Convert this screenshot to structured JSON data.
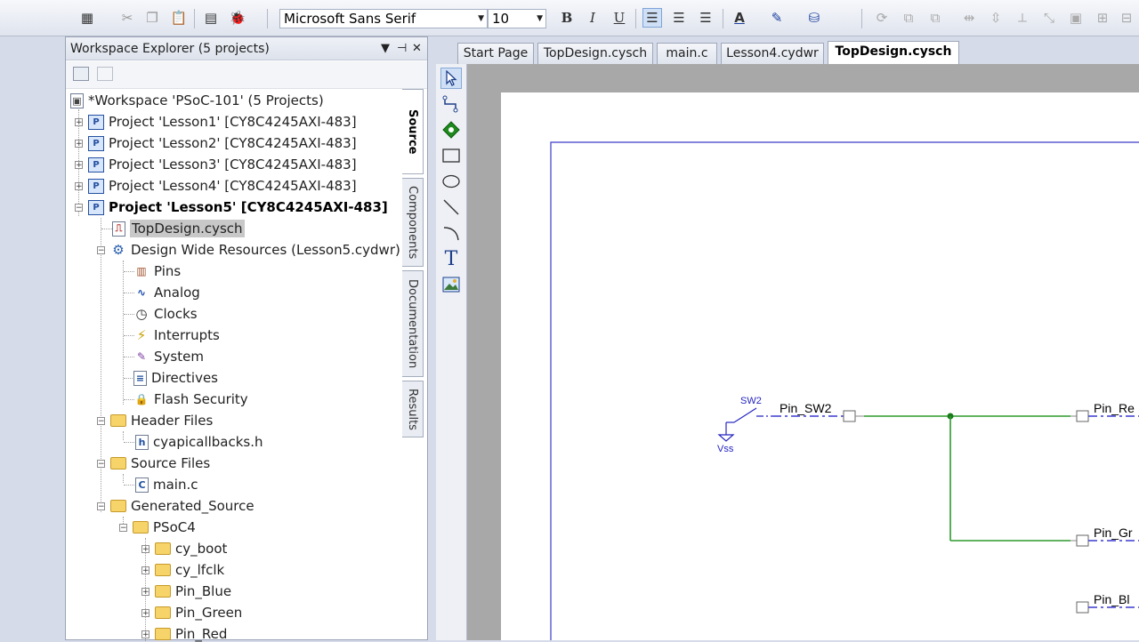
{
  "toolbar": {
    "font_name": "Microsoft Sans Serif",
    "font_size": "10",
    "bold_label": "B",
    "italic_label": "I",
    "underline_label": "U",
    "font_color_label": "A"
  },
  "explorer": {
    "title": "Workspace Explorer (5 projects)",
    "pin_icon": "pin-icon",
    "close_icon": "close-icon",
    "tree": {
      "workspace": "*Workspace 'PSoC-101' (5 Projects)",
      "projects": [
        "Project  'Lesson1' [CY8C4245AXI-483]",
        "Project  'Lesson2' [CY8C4245AXI-483]",
        "Project  'Lesson3' [CY8C4245AXI-483]",
        "Project  'Lesson4' [CY8C4245AXI-483]",
        "Project  'Lesson5' [CY8C4245AXI-483]"
      ],
      "topdesign": "TopDesign.cysch",
      "dwr": "Design Wide Resources (Lesson5.cydwr)",
      "dwr_items": [
        "Pins",
        "Analog",
        "Clocks",
        "Interrupts",
        "System",
        "Directives",
        "Flash Security"
      ],
      "header_files": "Header Files",
      "header_file_items": [
        "cyapicallbacks.h"
      ],
      "source_files": "Source Files",
      "source_file_items": [
        "main.c"
      ],
      "generated_source": "Generated_Source",
      "psoc4": "PSoC4",
      "psoc4_items": [
        "cy_boot",
        "cy_lfclk",
        "Pin_Blue",
        "Pin_Green",
        "Pin_Red"
      ]
    },
    "side_tabs": [
      "Source",
      "Components",
      "Documentation",
      "Results"
    ]
  },
  "doc_tabs": [
    "Start Page",
    "TopDesign.cysch",
    "main.c",
    "Lesson4.cydwr",
    "TopDesign.cysch"
  ],
  "palette_tools": [
    "select-icon",
    "wire-icon",
    "component-icon",
    "rectangle-icon",
    "ellipse-icon",
    "line-icon",
    "arc-icon",
    "text-icon",
    "image-icon"
  ],
  "schematic": {
    "switch_label": "SW2",
    "vss_label": "Vss",
    "pin_sw2": "Pin_SW2",
    "pin_red": "Pin_Re",
    "pin_green": "Pin_Gr",
    "pin_blue": "Pin_Bl",
    "wire_color": "#2d9a2d",
    "label_color": "#1a1ad0"
  }
}
